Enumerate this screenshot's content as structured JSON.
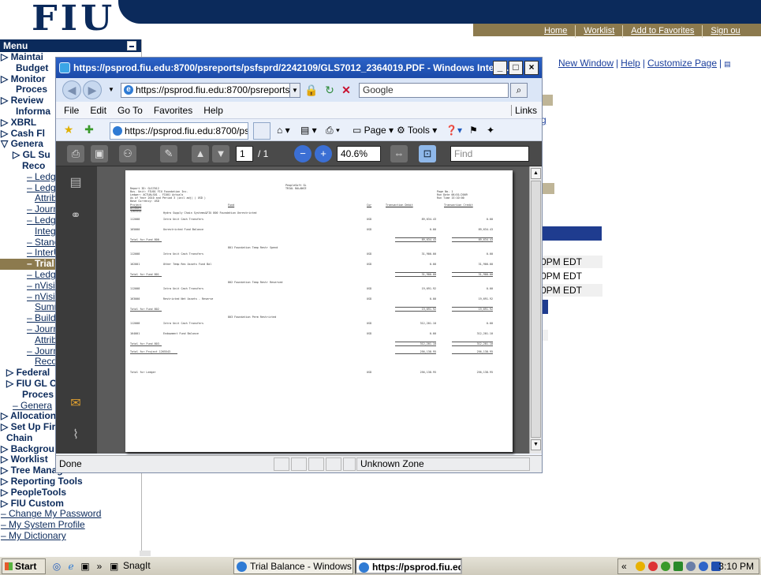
{
  "header": {
    "logo": "FIU",
    "nav": [
      "Home",
      "Worklist",
      "Add to Favorites",
      "Sign ou"
    ]
  },
  "menu": {
    "title": "Menu",
    "items": [
      {
        "label": "▷ Maintai",
        "cls": "l0"
      },
      {
        "label": "Budget",
        "cls": "l1i"
      },
      {
        "label": "▷ Monitor",
        "cls": "l0"
      },
      {
        "label": "Proces",
        "cls": "l1i"
      },
      {
        "label": "▷ Review",
        "cls": "l0"
      },
      {
        "label": "Informa",
        "cls": "l1i"
      },
      {
        "label": "▷ XBRL",
        "cls": "l0"
      },
      {
        "label": "▷ Cash Fl",
        "cls": "l0"
      },
      {
        "label": "▽ Genera",
        "cls": "l0"
      },
      {
        "label": "▷ GL Su",
        "cls": "l2"
      },
      {
        "label": "Reco",
        "cls": "l2i"
      },
      {
        "label": "– Ledge",
        "cls": "l3",
        "link": true
      },
      {
        "label": "– Ledge",
        "cls": "l3",
        "link": true
      },
      {
        "label": "Attribu",
        "cls": "l3i",
        "link": true
      },
      {
        "label": "– Journ",
        "cls": "l3",
        "link": true
      },
      {
        "label": "– Ledge",
        "cls": "l3",
        "link": true
      },
      {
        "label": "Integr",
        "cls": "l3i",
        "link": true
      },
      {
        "label": "– Stanc",
        "cls": "l3",
        "link": true
      },
      {
        "label": "– InterU",
        "cls": "l3",
        "link": true
      },
      {
        "label": "– Trial",
        "cls": "l3",
        "sel": true
      },
      {
        "label": "– Ledge",
        "cls": "l3",
        "link": true
      },
      {
        "label": "– nVisio",
        "cls": "l3",
        "link": true
      },
      {
        "label": "– nVisio",
        "cls": "l3",
        "link": true
      },
      {
        "label": "Sumr",
        "cls": "l3i",
        "link": true
      },
      {
        "label": "– Build",
        "cls": "l3",
        "link": true
      },
      {
        "label": "– Journ",
        "cls": "l3",
        "link": true
      },
      {
        "label": "Attribu",
        "cls": "l3i",
        "link": true
      },
      {
        "label": "– Journ",
        "cls": "l3",
        "link": true
      },
      {
        "label": "Reco",
        "cls": "l3i",
        "link": true
      },
      {
        "label": "▷ Federal",
        "cls": "l1"
      },
      {
        "label": "▷ FIU GL C",
        "cls": "l1"
      },
      {
        "label": "Proces",
        "cls": "l2i"
      },
      {
        "label": "– Genera",
        "cls": "l2",
        "link": true
      },
      {
        "label": "▷ Allocation",
        "cls": "l0"
      },
      {
        "label": "▷ Set Up Fir",
        "cls": "l0"
      },
      {
        "label": "Chain",
        "cls": "l1"
      },
      {
        "label": "▷ Backgrou",
        "cls": "l0"
      },
      {
        "label": "▷ Worklist",
        "cls": "l0"
      },
      {
        "label": "▷ Tree Manager",
        "cls": "l0"
      },
      {
        "label": "▷ Reporting Tools",
        "cls": "l0"
      },
      {
        "label": "▷ PeopleTools",
        "cls": "l0"
      },
      {
        "label": "▷ FIU Custom",
        "cls": "l0"
      },
      {
        "label": "– Change My Password",
        "cls": "l0",
        "link": true
      },
      {
        "label": "– My System Profile",
        "cls": "l0",
        "link": true
      },
      {
        "label": "– My Dictionary",
        "cls": "l0",
        "link": true
      }
    ]
  },
  "page": {
    "links": [
      "New Window",
      "Help",
      "Customize Page"
    ],
    "g_mark": "g",
    "times": [
      "0PM EDT",
      "0PM EDT",
      "0PM EDT"
    ]
  },
  "ie": {
    "title": "https://psprod.fiu.edu:8700/psreports/psfsprd/2242109/GLS7012_2364019.PDF - Windows Intern...",
    "address": "https://psprod.fiu.edu:8700/psreports/p",
    "search_placeholder": "Google",
    "menus": [
      "File",
      "Edit",
      "Go To",
      "Favorites",
      "Help"
    ],
    "links_label": "Links",
    "tab_title": "https://psprod.fiu.edu:8700/psrepor...",
    "page_label": "Page",
    "tools_label": "Tools",
    "status": "Done",
    "zone": "Unknown Zone"
  },
  "pdf": {
    "page_current": "1",
    "page_total": "/ 1",
    "zoom": "40.6%",
    "find_placeholder": "Find",
    "report": {
      "header_left": [
        "Report ID: GLS7012",
        "Bus. Unit:  FIU01 FIU Foundation Inc.",
        "Ledger:   ACTUALS01  - FIU01 Actuals",
        "As of Year 2010 and Period   3 (incl adj) ( USD )",
        "Base Currency: USD"
      ],
      "header_center": [
        "PeopleSoft GL",
        "TRIAL BALANCE"
      ],
      "header_right": [
        "Page No.  1",
        "Run Date 06/01/2009",
        "Run Time 15:10:00"
      ],
      "col_project": "Project",
      "col_fund": "Fund",
      "col_cur": "Cur",
      "col_debit": "Transaction Debit",
      "col_credit": "Transaction Credit",
      "project_id": "1265543",
      "account_label": "Account",
      "groups": [
        {
          "title": "Hydro Supply Chain Systems&FIU  800  Foundation Unrestricted",
          "rows": [
            [
              "112008",
              "Intra Unit Cash Transfers",
              "USD",
              "89,634.43",
              "0.00"
            ],
            [
              "165000",
              "Unrestricted Fund Balance",
              "USD",
              "0.00",
              "89,634.43"
            ]
          ],
          "total_label": "Total for Fund 800",
          "totals": [
            "89,634.43",
            "89,634.43"
          ]
        },
        {
          "title": "801   Foundation Temp Restr Spend",
          "rows": [
            [
              "112008",
              "Intra Unit Cash Transfers",
              "USD",
              "31,900.00",
              "0.00"
            ],
            [
              "162001",
              "Other Temp Res Assets Fund Bal",
              "USD",
              "0.00",
              "31,900.00"
            ]
          ],
          "total_label": "Total for Fund 801",
          "totals": [
            "31,900.00",
            "31,900.00"
          ]
        },
        {
          "title": "802   Foundation Temp Restr Reserved",
          "rows": [
            [
              "112008",
              "Intra Unit Cash Transfers",
              "USD",
              "19,691.92",
              "0.00"
            ],
            [
              "163000",
              "Restricted Net Assets - Reserve",
              "USD",
              "0.00",
              "19,691.92"
            ]
          ],
          "total_label": "Total for Fund 802",
          "totals": [
            "19,691.92",
            "19,691.92"
          ]
        },
        {
          "title": "803   Foundation Perm Restricted",
          "rows": [
            [
              "112008",
              "Intra Unit Cash Transfers",
              "USD",
              "312,201.10",
              "0.00"
            ],
            [
              "164001",
              "Endowment Fund Balance",
              "USD",
              "0.00",
              "312,201.10"
            ]
          ],
          "total_label": "Total for Fund 803",
          "totals": [
            "312,201.10",
            "312,201.10"
          ]
        }
      ],
      "project_total_label": "Total for Project 1265543",
      "project_totals": [
        "256,138.95",
        "256,138.95"
      ],
      "ledger_total_label": "Total for Ledger",
      "ledger_cur": "USD",
      "ledger_totals": [
        "256,138.95",
        "256,138.95"
      ]
    }
  },
  "taskbar": {
    "start": "Start",
    "tasks": [
      "SnagIt",
      "Trial Balance - Windows I...",
      "https://psprod.fiu.ed..."
    ],
    "clock": "3:10 PM"
  }
}
